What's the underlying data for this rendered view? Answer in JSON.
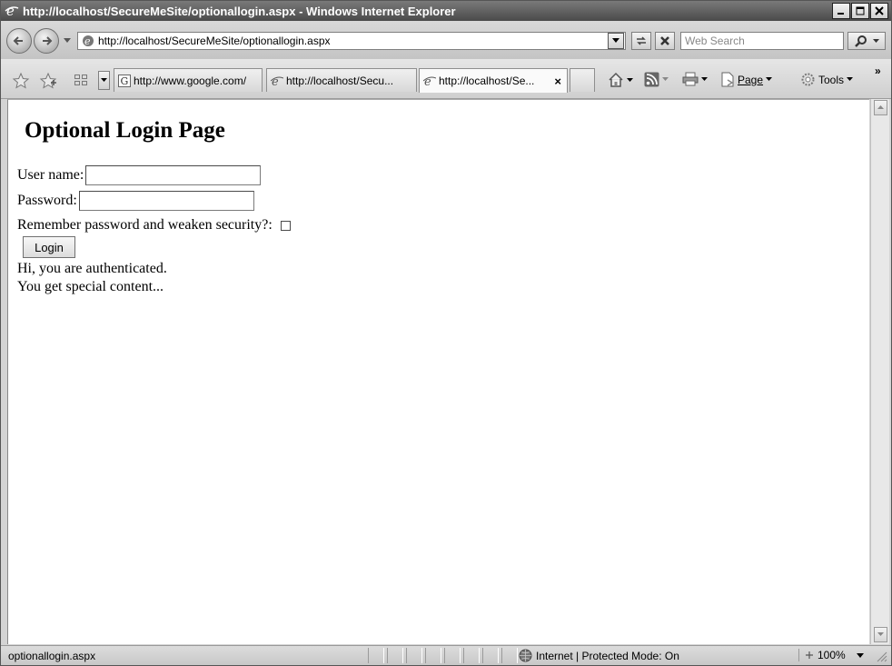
{
  "window": {
    "title": "http://localhost/SecureMeSite/optionallogin.aspx - Windows Internet Explorer"
  },
  "address": {
    "url": "http://localhost/SecureMeSite/optionallogin.aspx",
    "search_placeholder": "Web Search"
  },
  "tabs": [
    {
      "label": "http://www.google.com/",
      "icon": "google-icon"
    },
    {
      "label": "http://localhost/Secu...",
      "icon": "ie-page-icon"
    },
    {
      "label": "http://localhost/Se...",
      "icon": "ie-page-icon",
      "active": true
    }
  ],
  "commands": {
    "page_label": "Page",
    "tools_label": "Tools"
  },
  "page": {
    "heading": "Optional Login Page",
    "username_label": "User name:",
    "password_label": "Password:",
    "remember_label": "Remember password and weaken security?:",
    "login_button": "Login",
    "message_1": "Hi, you are authenticated.",
    "message_2": "You get special content..."
  },
  "status": {
    "text": "optionallogin.aspx",
    "zone": "Internet | Protected Mode: On",
    "zoom": "100%"
  }
}
